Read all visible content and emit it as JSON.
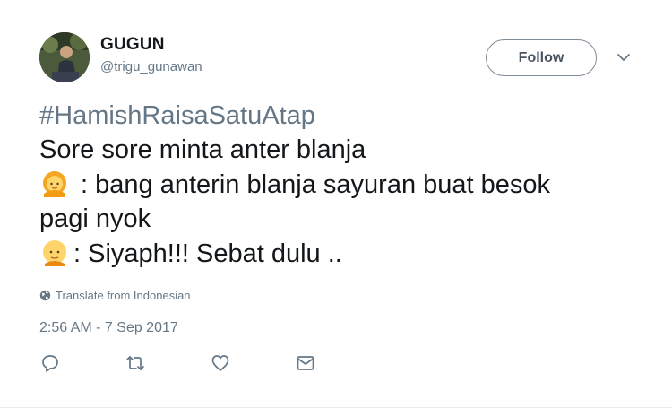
{
  "user": {
    "display_name": "GUGUN",
    "handle": "@trigu_gunawan"
  },
  "follow_button": {
    "label": "Follow"
  },
  "tweet": {
    "hashtag": "#HamishRaisaSatuAtap",
    "line1": "Sore sore minta anter blanja",
    "line2": " : bang anterin blanja sayuran buat besok",
    "line3": "pagi nyok",
    "line4": ": Siyaph!!! Sebat dulu .."
  },
  "translate": {
    "label": "Translate from Indonesian"
  },
  "timestamp": "2:56 AM - 7 Sep 2017",
  "actions": [
    "reply-icon",
    "retweet-icon",
    "like-icon",
    "direct-message-icon"
  ],
  "colors": {
    "text": "#14171a",
    "secondary": "#657786",
    "hashtag": "#657786",
    "button_border": "#7f8c98"
  }
}
